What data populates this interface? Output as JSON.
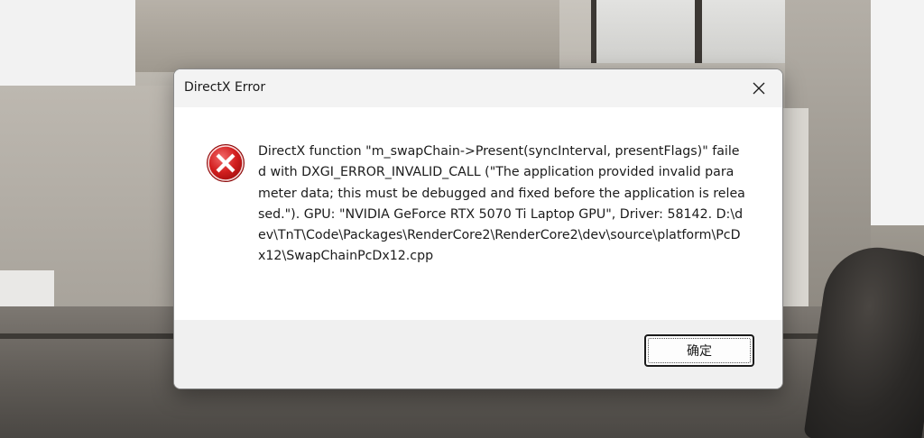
{
  "dialog": {
    "title": "DirectX Error",
    "close_icon": "close-icon",
    "error_icon": "error-icon",
    "message": "DirectX function \"m_swapChain->Present(syncInterval, presentFlags)\" failed with DXGI_ERROR_INVALID_CALL (\"The application provided invalid parameter data; this must be debugged and fixed before the application is released.\"). GPU: \"NVIDIA GeForce RTX 5070 Ti Laptop GPU\", Driver: 58142. D:\\dev\\TnT\\Code\\Packages\\RenderCore2\\RenderCore2\\dev\\source\\platform\\PcDx12\\SwapChainPcDx12.cpp",
    "ok_label": "确定"
  },
  "colors": {
    "error_red": "#d21f1f",
    "titlebar_bg": "#f3f3f3",
    "footer_bg": "#f0f0f0"
  }
}
